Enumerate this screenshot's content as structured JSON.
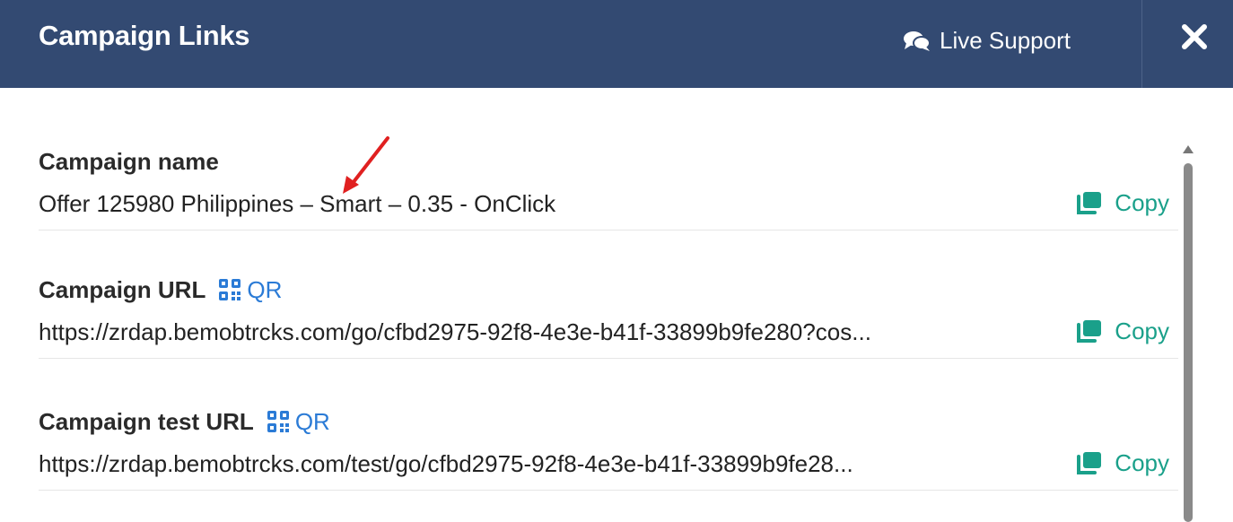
{
  "header": {
    "title": "Campaign Links",
    "live_support_label": "Live Support",
    "icons": {
      "chat": "chat-bubbles-icon",
      "close": "close-icon"
    }
  },
  "fields": [
    {
      "label": "Campaign name",
      "value": "Offer 125980 Philippines – Smart – 0.35 - OnClick",
      "copy_label": "Copy"
    },
    {
      "label": "Campaign URL",
      "qr_label": "QR",
      "value": "https://zrdap.bemobtrcks.com/go/cfbd2975-92f8-4e3e-b41f-33899b9fe280?cos...",
      "copy_label": "Copy"
    },
    {
      "label": "Campaign test URL",
      "qr_label": "QR",
      "value": "https://zrdap.bemobtrcks.com/test/go/cfbd2975-92f8-4e3e-b41f-33899b9fe28...",
      "copy_label": "Copy"
    }
  ],
  "colors": {
    "header_bg": "#334a72",
    "copy_accent": "#1aa08a",
    "qr_accent": "#2b7bd6",
    "annotation_arrow": "#e02020"
  }
}
